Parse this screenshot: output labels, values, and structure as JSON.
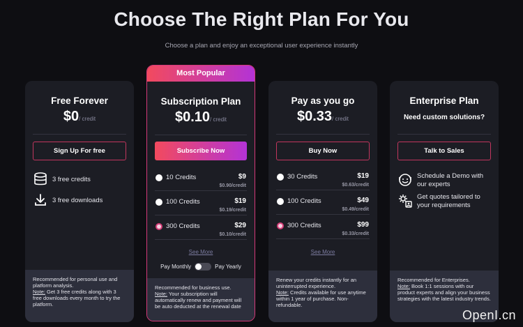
{
  "header": {
    "title": "Choose The Right Plan For You",
    "subtitle": "Choose a plan and enjoy an exceptional user experience instantly"
  },
  "plans": [
    {
      "name": "Free Forever",
      "price": "$0",
      "unit": "/ credit",
      "button": "Sign Up For free",
      "features": [
        {
          "icon": "database-icon",
          "text": "3 free credits"
        },
        {
          "icon": "download-icon",
          "text": "3 free downloads"
        }
      ],
      "footer_text": "Recommended for personal use and platform analysis.",
      "footer_note_label": "Note:",
      "footer_note": " Get 3 free credits along with 3 free downloads every month to try the platform."
    },
    {
      "badge": "Most Popular",
      "name": "Subscription Plan",
      "price": "$0.10",
      "unit": "/ credit",
      "button": "Subscribe Now",
      "options": [
        {
          "label": "10 Credits",
          "amount": "$9",
          "per": "$0.90/credit",
          "selected": false
        },
        {
          "label": "100 Credits",
          "amount": "$19",
          "per": "$0.19/credit",
          "selected": false
        },
        {
          "label": "300 Credits",
          "amount": "$29",
          "per": "$0.10/credit",
          "selected": true
        }
      ],
      "see_more": "See More",
      "toggle_left": "Pay Monthly",
      "toggle_right": "Pay Yearly",
      "footer_text": "Recommended for business use.",
      "footer_note_label": "Note:",
      "footer_note": " Your subscription will automatically renew and payment will be auto deducted at the renewal date"
    },
    {
      "name": "Pay as you go",
      "price": "$0.33",
      "unit": "/ credit",
      "button": "Buy Now",
      "options": [
        {
          "label": "30 Credits",
          "amount": "$19",
          "per": "$0.63/credit",
          "selected": false
        },
        {
          "label": "100 Credits",
          "amount": "$49",
          "per": "$0.49/credit",
          "selected": false
        },
        {
          "label": "300 Credits",
          "amount": "$99",
          "per": "$0.33/credit",
          "selected": true
        }
      ],
      "see_more": "See More",
      "footer_text": "Renew your credits instantly for an uninterrupted experience.",
      "footer_note_label": "Note:",
      "footer_note": " Credits available for use anytime within 1 year of purchase. Non-refundable."
    },
    {
      "name": "Enterprise Plan",
      "subtitle": "Need custom solutions?",
      "button": "Talk to Sales",
      "features": [
        {
          "icon": "headset-icon",
          "text": "Schedule a Demo with our experts"
        },
        {
          "icon": "settings-user-icon",
          "text": "Get quotes tailored to your requirements"
        }
      ],
      "footer_text": "Recommended for Enterprises.",
      "footer_note_label": "Note:",
      "footer_note": " Book 1:1 sessions with our product experts and align your business strategies with the latest industry trends."
    }
  ],
  "watermark": "OpenI.cn",
  "colors": {
    "background": "#0e0e12",
    "card": "#1c1d24",
    "footer": "#2d2f3c",
    "accent_start": "#f24a5e",
    "accent_end": "#b333d6"
  }
}
